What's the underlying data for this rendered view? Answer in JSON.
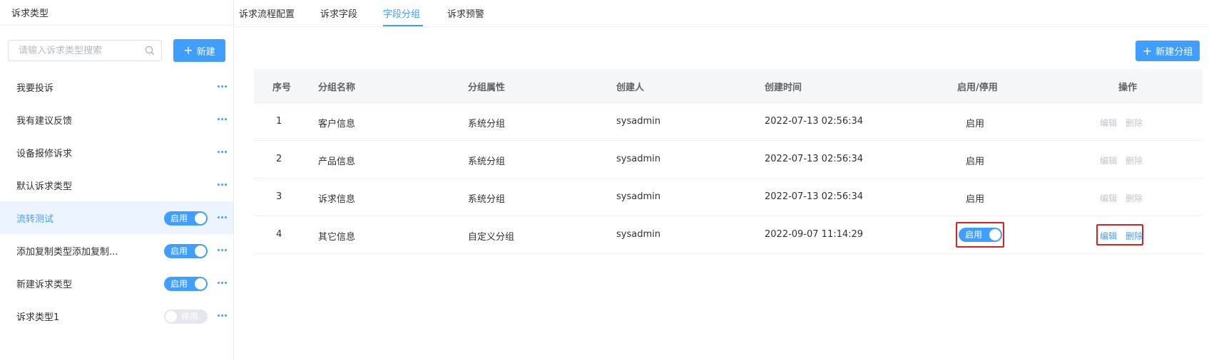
{
  "sidebar": {
    "title": "诉求类型",
    "search_placeholder": "请输入诉求类型搜索",
    "new_button": "新建",
    "items": [
      {
        "label": "我要投诉",
        "has_switch": false
      },
      {
        "label": "我有建议反馈",
        "has_switch": false
      },
      {
        "label": "设备报修诉求",
        "has_switch": false
      },
      {
        "label": "默认诉求类型",
        "has_switch": false
      },
      {
        "label": "流转测试",
        "has_switch": true,
        "switch_text": "启用",
        "switch_on": true,
        "active": true
      },
      {
        "label": "添加复制类型添加复制...",
        "has_switch": true,
        "switch_text": "启用",
        "switch_on": true
      },
      {
        "label": "新建诉求类型",
        "has_switch": true,
        "switch_text": "启用",
        "switch_on": true
      },
      {
        "label": "诉求类型1",
        "has_switch": true,
        "switch_text": "停用",
        "switch_on": false
      }
    ]
  },
  "tabs": [
    {
      "label": "诉求流程配置",
      "active": false
    },
    {
      "label": "诉求字段",
      "active": false
    },
    {
      "label": "字段分组",
      "active": true
    },
    {
      "label": "诉求预警",
      "active": false
    }
  ],
  "toolbar": {
    "new_group_button": "新建分组"
  },
  "table": {
    "columns": [
      "序号",
      "分组名称",
      "分组属性",
      "创建人",
      "创建时间",
      "启用/停用",
      "操作"
    ],
    "rows": [
      {
        "no": "1",
        "name": "客户信息",
        "attr": "系统分组",
        "creator": "sysadmin",
        "time": "2022-07-13 02:56:34",
        "status": "启用",
        "status_is_switch": false,
        "edit": "编辑",
        "delete": "删除",
        "ops_enabled": false
      },
      {
        "no": "2",
        "name": "产品信息",
        "attr": "系统分组",
        "creator": "sysadmin",
        "time": "2022-07-13 02:56:34",
        "status": "启用",
        "status_is_switch": false,
        "edit": "编辑",
        "delete": "删除",
        "ops_enabled": false
      },
      {
        "no": "3",
        "name": "诉求信息",
        "attr": "系统分组",
        "creator": "sysadmin",
        "time": "2022-07-13 02:56:34",
        "status": "启用",
        "status_is_switch": false,
        "edit": "编辑",
        "delete": "删除",
        "ops_enabled": false
      },
      {
        "no": "4",
        "name": "其它信息",
        "attr": "自定义分组",
        "creator": "sysadmin",
        "time": "2022-09-07 11:14:29",
        "status": "启用",
        "status_is_switch": true,
        "edit": "编辑",
        "delete": "删除",
        "ops_enabled": true
      }
    ]
  },
  "colors": {
    "accent": "#409eff",
    "highlight": "#e01e1e",
    "disabled_text": "#c0c4cc"
  },
  "icons": {
    "search": "search-icon",
    "more": "more-horizontal-icon",
    "plus": "plus-icon"
  }
}
